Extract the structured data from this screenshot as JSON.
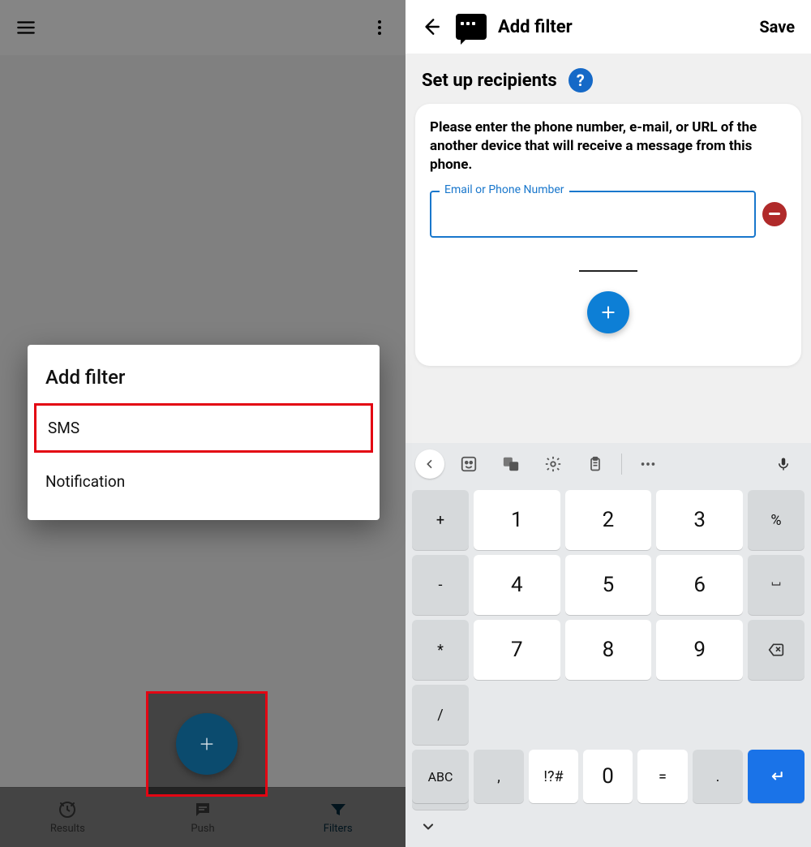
{
  "left": {
    "dialog_title": "Add filter",
    "options": {
      "sms": "SMS",
      "notification": "Notification"
    },
    "nav": {
      "results": "Results",
      "push": "Push",
      "filters": "Filters"
    }
  },
  "right": {
    "title": "Add filter",
    "save": "Save",
    "section": "Set up recipients",
    "help": "?",
    "instruction": "Please enter the phone number, e-mail, or URL of the another device that will receive a message from this phone.",
    "field_label": "Email or Phone Number",
    "field_value": ""
  },
  "keyboard": {
    "side_left": [
      "+",
      "-",
      "*",
      "/"
    ],
    "digits": [
      [
        "1",
        "2",
        "3"
      ],
      [
        "4",
        "5",
        "6"
      ],
      [
        "7",
        "8",
        "9"
      ]
    ],
    "side_right": [
      "%",
      "␣",
      "",
      "⌫"
    ],
    "bottom": {
      "abc": "ABC",
      "comma": ",",
      "sym": "!?#",
      "zero": "0",
      "eq": "=",
      "dot": "."
    }
  }
}
